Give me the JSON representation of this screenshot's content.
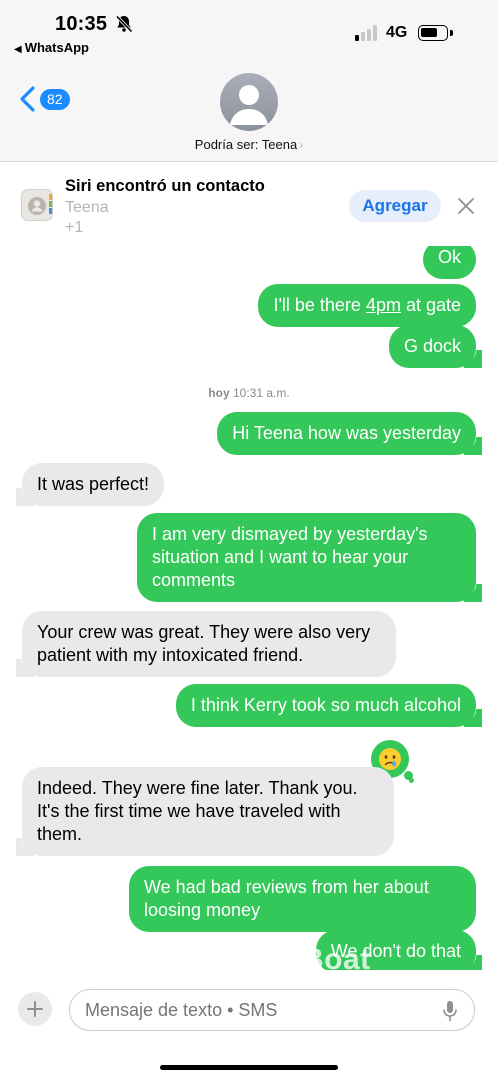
{
  "status_bar": {
    "time": "10:35",
    "back_app": "WhatsApp",
    "network": "4G"
  },
  "nav": {
    "unread_count": "82",
    "contact_label": "Podría ser: Teena",
    "chevron": "›"
  },
  "siri_suggestion": {
    "title": "Siri encontró un contacto",
    "name": "Teena",
    "phone": "+1",
    "add_label": "Agregar"
  },
  "messages": [
    {
      "from": "me",
      "text": "Ok"
    },
    {
      "from": "me",
      "text_before": "I'll be there ",
      "link": "4pm",
      "text_after": " at gate"
    },
    {
      "from": "me",
      "text": "G dock"
    },
    {
      "from": "me",
      "text": "Hi Teena how was yesterday"
    },
    {
      "from": "them",
      "text": "It was perfect!"
    },
    {
      "from": "me",
      "text": "I am very dismayed by yesterday's situation and I want to hear your comments"
    },
    {
      "from": "them",
      "text": "Your crew was great. They were also very patient with my intoxicated friend."
    },
    {
      "from": "me",
      "text": "I think Kerry took so much alcohol"
    },
    {
      "from": "them",
      "text": "Indeed. They were fine later. Thank you. It's the first time we have traveled with them."
    },
    {
      "from": "me",
      "text": "We had bad reviews from her about loosing money"
    },
    {
      "from": "me",
      "text": "We don't do that"
    }
  ],
  "timestamp": {
    "day": "hoy",
    "time": "10:31 a.m."
  },
  "tapback_icon": "crying-face-emoji",
  "watermark": "Boat",
  "compose": {
    "placeholder": "Mensaje de texto • SMS"
  },
  "colors": {
    "outgoing": "#34c759",
    "incoming": "#e9e9eb",
    "accent": "#1a8cff"
  }
}
